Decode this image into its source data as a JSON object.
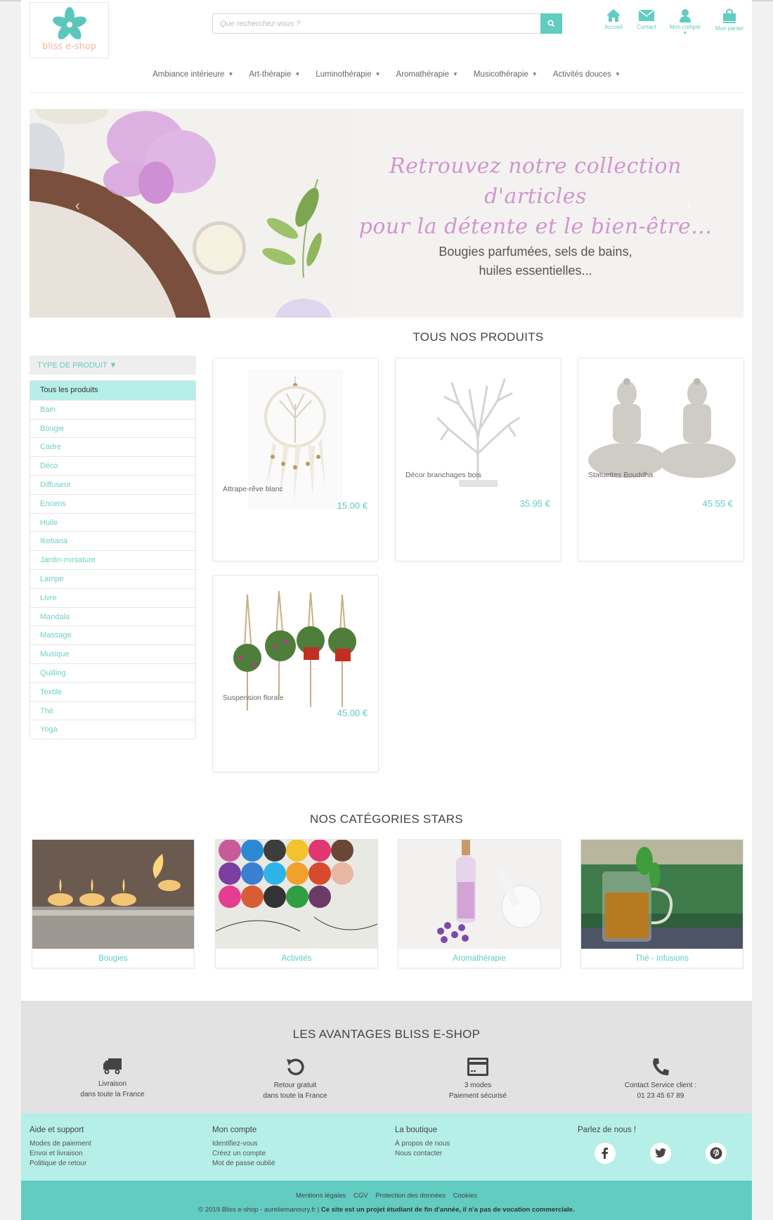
{
  "brand": {
    "name": "bliss e-shop",
    "accent": "#62cbc2",
    "accent_light": "#b6efe7"
  },
  "search": {
    "placeholder": "Que recherchez-vous ?",
    "value": ""
  },
  "header_nav": [
    {
      "label": "Accueil",
      "icon": "home-icon"
    },
    {
      "label": "Contact",
      "icon": "envelope-icon"
    },
    {
      "label": "Mon compte",
      "icon": "user-icon"
    },
    {
      "label": "Mon panier",
      "icon": "shopping-bag-icon"
    }
  ],
  "menu": [
    {
      "label": "Ambiance intérieure"
    },
    {
      "label": "Art-thérapie"
    },
    {
      "label": "Luminothérapie"
    },
    {
      "label": "Aromathérapie"
    },
    {
      "label": "Musicothérapie"
    },
    {
      "label": "Activités douces"
    }
  ],
  "hero": {
    "title_line1": "Retrouvez notre collection d'articles",
    "title_line2": "pour la détente et le bien-être...",
    "subtitle_line1": "Bougies parfumées, sels de bains,",
    "subtitle_line2": "huiles essentielles..."
  },
  "products_section": {
    "title": "TOUS NOS PRODUITS"
  },
  "filter": {
    "header": "TYPE DE PRODUIT ▼",
    "items": [
      "Tous les produits",
      "Bain",
      "Bougie",
      "Cadre",
      "Déco",
      "Diffuseur",
      "Encens",
      "Huile",
      "Ikebana",
      "Jardin-miniature",
      "Lampe",
      "Livre",
      "Mandala",
      "Massage",
      "Musique",
      "Quilling",
      "Textile",
      "Thé",
      "Yoga"
    ],
    "active": "Tous les produits"
  },
  "products": [
    {
      "name": "Attrape-rêve blanc",
      "price": "15.00 €",
      "image": "dreamcatcher"
    },
    {
      "name": "Décor branchages bois",
      "price": "35.95 €",
      "image": "branch-decor"
    },
    {
      "name": "Statuettes Bouddha",
      "price": "45.55 €",
      "image": "buddha-statues"
    },
    {
      "name": "Suspension florale",
      "price": "45.00 €",
      "image": "hanging-planters"
    }
  ],
  "categories_section": {
    "title": "NOS CATÉGORIES STARS"
  },
  "star_categories": [
    {
      "label": "Bougies"
    },
    {
      "label": "Activités"
    },
    {
      "label": "Aromathérapie"
    },
    {
      "label": "Thé - Infusions"
    }
  ],
  "advantages": {
    "title": "LES AVANTAGES BLISS E-SHOP",
    "items": [
      {
        "icon": "truck-icon",
        "line1": "Livraison",
        "line2": "dans toute la France"
      },
      {
        "icon": "return-icon",
        "line1": "Retour gratuit",
        "line2": "dans toute la France"
      },
      {
        "icon": "credit-card-icon",
        "line1": "3 modes",
        "line2": "Paiement sécurisé"
      },
      {
        "icon": "phone-icon",
        "line1": "Contact Service client :",
        "line2": "01 23 45 67 89"
      }
    ]
  },
  "footer": {
    "columns": [
      {
        "title": "Aide et support",
        "links": [
          "Modes de paiement",
          "Envoi et livraison",
          "Politique de retour"
        ]
      },
      {
        "title": "Mon compte",
        "links": [
          "Identifiez-vous",
          "Créez un compte",
          "Mot de passe oublié"
        ]
      },
      {
        "title": "La boutique",
        "links": [
          "À propos de nous",
          "Nous contacter"
        ]
      }
    ],
    "social_title": "Parlez de nous !",
    "social": [
      "facebook",
      "twitter",
      "pinterest"
    ],
    "legal_links": [
      "Mentions légales",
      "CGV",
      "Protection des données",
      "Cookies"
    ],
    "copyright": "© 2019 Bliss e-shop - aureliemanoury.fr |",
    "disclaimer": "Ce site est un projet étudiant de fin d'année, il n'a pas de vocation commerciale."
  }
}
